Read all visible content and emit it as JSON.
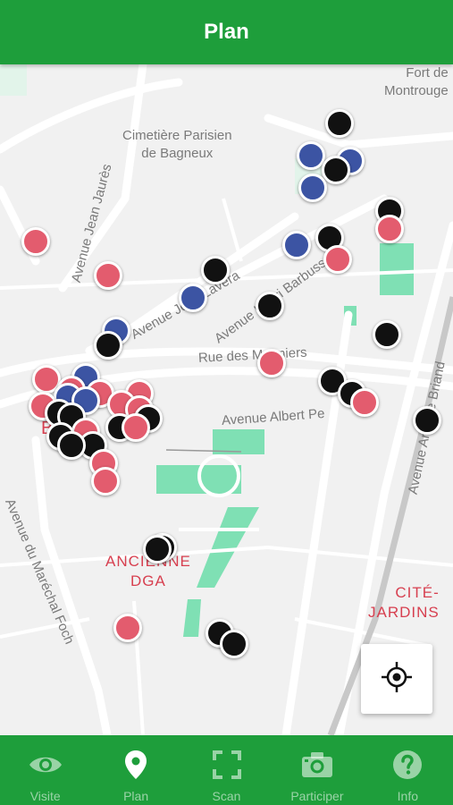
{
  "header": {
    "title": "Plan"
  },
  "map": {
    "labels": {
      "fort": "Fort de\nMontrouge",
      "cemetery": "Cimetière Parisien\nde Bagneux",
      "av_jean_jaures": "Avenue Jean Jaurès",
      "av_vera": "Avenue Jean Lavera",
      "av_henri": "Avenue Henri Barbusse",
      "rue_meuniers": "Rue des Meuniers",
      "av_albert": "Avenue Albert Pe",
      "av_briand": "Avenue Aristide Briand",
      "av_foch": "Avenue du Maréchal Foch",
      "ancienne": "ANCIENNE\nDGA",
      "cite": "CITÉ-\nJARDINS",
      "bagneux_partial": "B"
    },
    "marker_colors": {
      "red": "#e35c6e",
      "blue": "#3c54a3",
      "black": "#111111"
    }
  },
  "locate_button": {
    "icon": "crosshair-icon"
  },
  "tabbar": {
    "tabs": [
      {
        "label": "Visite",
        "icon": "eye-icon",
        "active": false
      },
      {
        "label": "Plan",
        "icon": "map-pin-icon",
        "active": true
      },
      {
        "label": "Scan",
        "icon": "scan-frame-icon",
        "active": false
      },
      {
        "label": "Participer",
        "icon": "camera-icon",
        "active": false
      },
      {
        "label": "Info",
        "icon": "help-circle-icon",
        "active": false
      }
    ]
  },
  "colors": {
    "brand_green": "#1e9e3b",
    "park_green": "#7fe0b4"
  }
}
